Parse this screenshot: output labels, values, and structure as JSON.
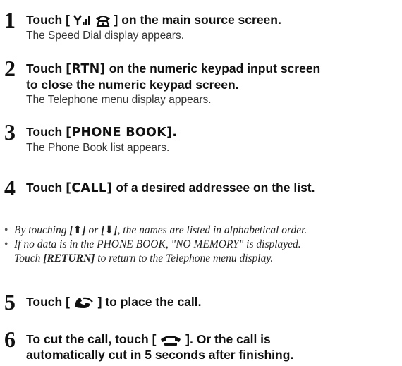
{
  "steps": [
    {
      "number": "1",
      "pre": "Touch",
      "button": "[         ]",
      "post": "on the main source screen.",
      "result": "The Speed Dial display appears.",
      "icons": [
        "antenna-signal-icon",
        "phone-handset-icon"
      ]
    },
    {
      "number": "2",
      "pre": "Touch",
      "button": "[RTN]",
      "post": "on the numeric keypad input screen",
      "line2": "to close the numeric keypad screen.",
      "result": "The Telephone menu display appears."
    },
    {
      "number": "3",
      "pre": "Touch",
      "button": "[PHONE BOOK].",
      "result": "The Phone Book list appears."
    },
    {
      "number": "4",
      "pre": "Touch",
      "button": "[CALL]",
      "post": "of a desired addressee on the list."
    },
    {
      "number": "5",
      "pre": "Touch",
      "post": "to place the call.",
      "icons": [
        "call-place-icon"
      ]
    },
    {
      "number": "6",
      "pre": "To cut the call, touch",
      "post": ". Or the call is",
      "line2": "automatically cut in 5 seconds after finishing.",
      "icons": [
        "call-end-icon"
      ]
    }
  ],
  "notes": [
    {
      "pre": "By touching",
      "b1": "[⬆]",
      "mid": "or",
      "b2": "[⬇]",
      "post": ", the names are listed in alphabetical order."
    },
    {
      "line1": "If no data is in the PHONE BOOK, \"NO MEMORY\" is displayed.",
      "pre2": "Touch",
      "b1": "[RETURN]",
      "post2": "to return to the Telephone menu display."
    }
  ]
}
